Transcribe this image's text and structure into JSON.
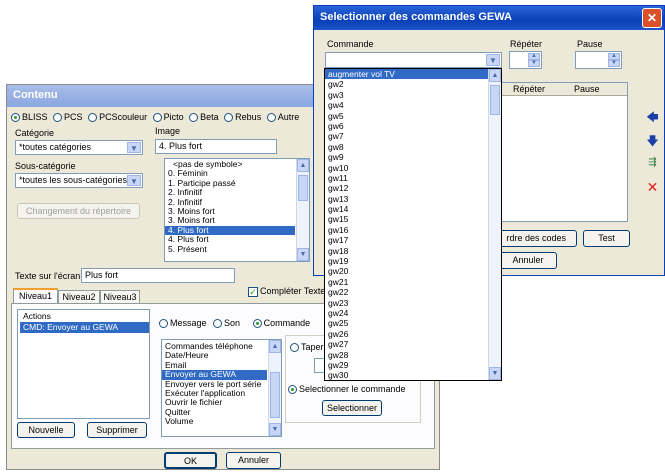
{
  "contenu": {
    "title": "Contenu",
    "radios": [
      "BLISS",
      "PCS",
      "PCScouleur",
      "Picto",
      "Beta",
      "Rebus",
      "Autre"
    ],
    "categorie_label": "Catégorie",
    "categorie_value": "*toutes catégories",
    "souscat_label": "Sous-catégorie",
    "souscat_value": "*toutes les sous-catégories",
    "change_dir_button": "Changement du répertoire",
    "image_label": "Image",
    "image_value": "4. Plus fort",
    "image_list": [
      "<pas de symbole>",
      "0. Féminin",
      "1. Participe passé",
      "2. Infinitif",
      "2. Infinitif",
      "3. Moins fort",
      "3. Moins fort",
      "4. Plus fort",
      "4. Plus fort",
      "5. Présent"
    ],
    "image_selected_index": 7,
    "texte_label": "Texte sur l'écran",
    "texte_value": "Plus fort",
    "completer_label": "Compléter Texte",
    "tabs": [
      "Niveau1",
      "Niveau2",
      "Niveau3"
    ],
    "actions_header": "Actions",
    "actions_item": "CMD: Envoyer au GEWA",
    "nouvelle_button": "Nouvelle",
    "supprimer_button": "Supprimer",
    "type_radios": [
      "Message",
      "Son",
      "Commande"
    ],
    "commands_list": [
      "Commandes téléphone",
      "Date/Heure",
      "Email",
      "Envoyer au GEWA",
      "Envoyer vers le port série",
      "Exécuter l'application",
      "Ouvrir le fichier",
      "Quitter",
      "Volume"
    ],
    "commands_selected_index": 3,
    "taper_label": "Taper",
    "selectionner_radio": "Selectionner le commande",
    "selectionner_button": "Selectionner",
    "ok_button": "OK",
    "annuler_button": "Annuler"
  },
  "gewa": {
    "title": "Selectionner des commandes GEWA",
    "commande_label": "Commande",
    "repeter_label": "Répéter",
    "pause_label": "Pause",
    "table_headers": [
      "Répéter",
      "Pause"
    ],
    "dropdown_items": [
      "augmenter vol TV",
      "gw2",
      "gw3",
      "gw4",
      "gw5",
      "gw6",
      "gw7",
      "gw8",
      "gw9",
      "gw10",
      "gw11",
      "gw12",
      "gw13",
      "gw14",
      "gw15",
      "gw16",
      "gw17",
      "gw18",
      "gw19",
      "gw20",
      "gw21",
      "gw22",
      "gw23",
      "gw24",
      "gw25",
      "gw26",
      "gw27",
      "gw28",
      "gw29",
      "gw30"
    ],
    "dropdown_selected_index": 0,
    "codes_button": "rdre des codes",
    "test_button": "Test",
    "annuler_button": "Annuler",
    "close_glyph": "✕"
  }
}
